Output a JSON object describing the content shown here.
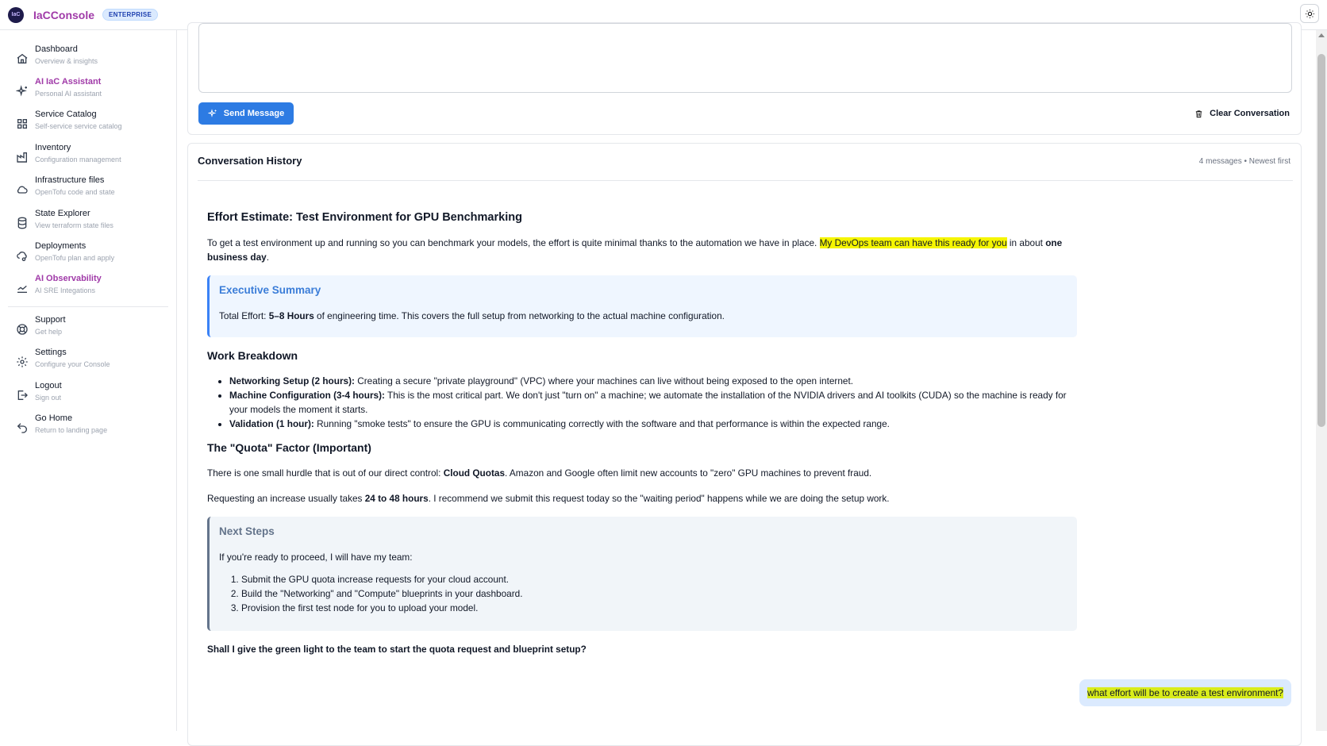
{
  "app": {
    "logo_text": "IaC",
    "brand": "IaCConsole",
    "badge": "ENTERPRISE"
  },
  "sidebar": {
    "items": [
      {
        "title": "Dashboard",
        "sub": "Overview & insights",
        "icon": "home-icon"
      },
      {
        "title": "AI IaC Assistant",
        "sub": "Personal AI assistant",
        "icon": "sparkles-icon"
      },
      {
        "title": "Service Catalog",
        "sub": "Self-service service catalog",
        "icon": "grid-icon"
      },
      {
        "title": "Inventory",
        "sub": "Configuration management",
        "icon": "factory-icon"
      },
      {
        "title": "Infrastructure files",
        "sub": "OpenTofu code and state",
        "icon": "cloud-icon"
      },
      {
        "title": "State Explorer",
        "sub": "View terraform state files",
        "icon": "database-icon"
      },
      {
        "title": "Deployments",
        "sub": "OpenTofu plan and apply",
        "icon": "cloud-sync-icon"
      },
      {
        "title": "AI Observability",
        "sub": "AI SRE Integations",
        "icon": "chart-line-icon"
      },
      {
        "title": "Support",
        "sub": "Get help",
        "icon": "lifebuoy-icon"
      },
      {
        "title": "Settings",
        "sub": "Configure your Console",
        "icon": "gear-icon"
      },
      {
        "title": "Logout",
        "sub": "Sign out",
        "icon": "logout-icon"
      },
      {
        "title": "Go Home",
        "sub": "Return to landing page",
        "icon": "undo-icon"
      }
    ]
  },
  "composer": {
    "send_label": "Send Message",
    "clear_label": "Clear Conversation"
  },
  "history": {
    "title": "Conversation History",
    "meta": "4 messages • Newest first",
    "assistant": {
      "heading": "Effort Estimate: Test Environment for GPU Benchmarking",
      "intro_pre": "To get a test environment up and running so you can benchmark your models, the effort is quite minimal thanks to the automation we have in place. ",
      "intro_hl": "My DevOps team can have this ready for you",
      "intro_post": " in about ",
      "intro_bold": "one business day",
      "intro_end": ".",
      "summary_title": "Executive Summary",
      "summary_pre": "Total Effort: ",
      "summary_bold": "5–8 Hours",
      "summary_post": " of engineering time. This covers the full setup from networking to the actual machine configuration.",
      "breakdown_heading": "Work Breakdown",
      "breakdown": [
        {
          "bold": "Networking Setup (2 hours):",
          "text": " Creating a secure \"private playground\" (VPC) where your machines can live without being exposed to the open internet."
        },
        {
          "bold": "Machine Configuration (3-4 hours):",
          "text": " This is the most critical part. We don't just \"turn on\" a machine; we automate the installation of the NVIDIA drivers and AI toolkits (CUDA) so the machine is ready for your models the moment it starts."
        },
        {
          "bold": "Validation (1 hour):",
          "text": " Running \"smoke tests\" to ensure the GPU is communicating correctly with the software and that performance is within the expected range."
        }
      ],
      "quota_heading": "The \"Quota\" Factor (Important)",
      "quota_pre": "There is one small hurdle that is out of our direct control: ",
      "quota_bold": "Cloud Quotas",
      "quota_post": ". Amazon and Google often limit new accounts to \"zero\" GPU machines to prevent fraud.",
      "request_pre": "Requesting an increase usually takes ",
      "request_bold": "24 to 48 hours",
      "request_post": ". I recommend we submit this request today so the \"waiting period\" happens while we are doing the setup work.",
      "next_title": "Next Steps",
      "next_intro": "If you're ready to proceed, I will have my team:",
      "next_steps": [
        "Submit the GPU quota increase requests for your cloud account.",
        "Build the \"Networking\" and \"Compute\" blueprints in your dashboard.",
        "Provision the first test node for you to upload your model."
      ],
      "closing": "Shall I give the green light to the team to start the quota request and blueprint setup?"
    },
    "user_message": "what effort will be to create a test environment?"
  },
  "colors": {
    "brand": "#a03aa8",
    "primary": "#2d7be3",
    "highlight": "#f5f500"
  }
}
